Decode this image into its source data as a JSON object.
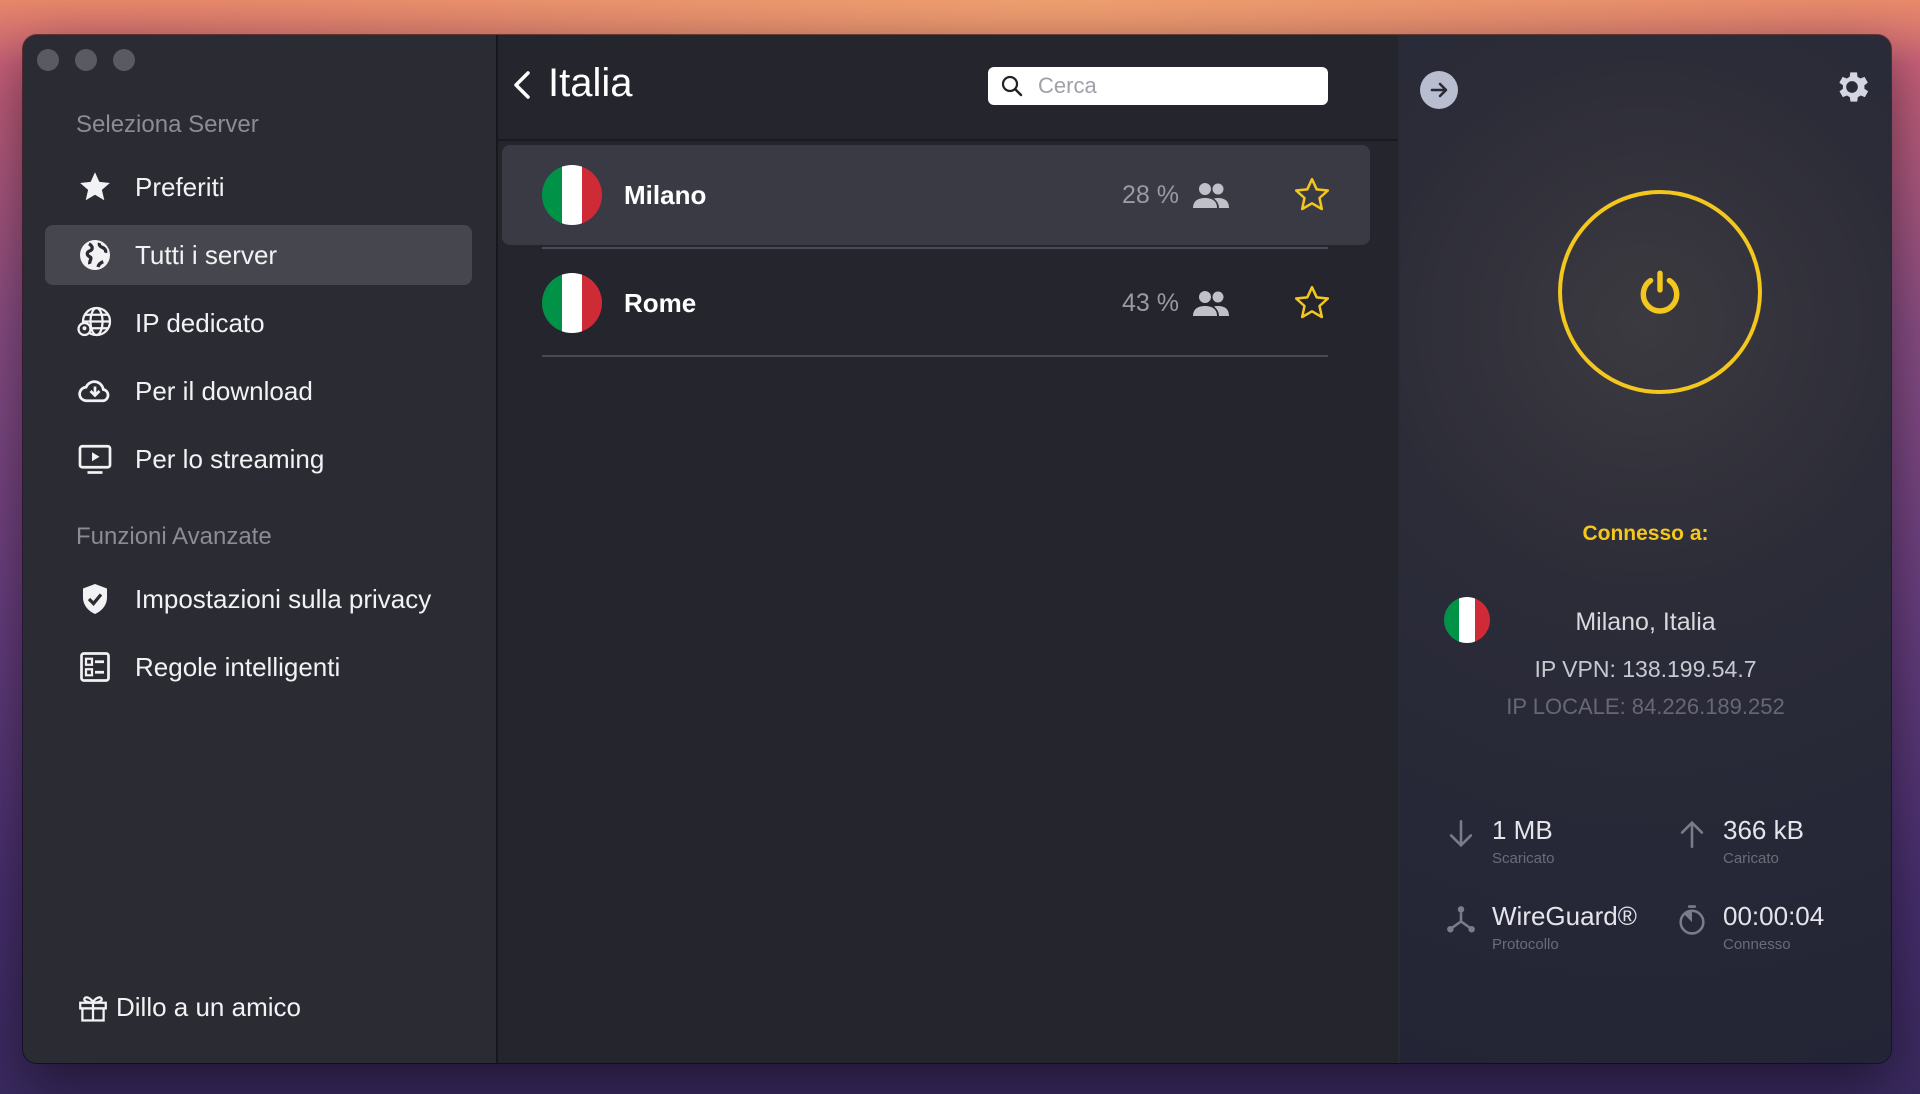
{
  "sidebar": {
    "section_servers": "Seleziona Server",
    "items": [
      {
        "label": "Preferiti",
        "icon": "star-icon"
      },
      {
        "label": "Tutti i server",
        "icon": "globe-icon"
      },
      {
        "label": "IP dedicato",
        "icon": "dedicated-ip-icon"
      },
      {
        "label": "Per il download",
        "icon": "cloud-download-icon"
      },
      {
        "label": "Per lo streaming",
        "icon": "play-screen-icon"
      }
    ],
    "section_advanced": "Funzioni Avanzate",
    "advanced_items": [
      {
        "label": "Impostazioni sulla privacy",
        "icon": "shield-check-icon"
      },
      {
        "label": "Regole intelligenti",
        "icon": "rules-list-icon"
      }
    ],
    "friend_label": "Dillo a un amico"
  },
  "server_list": {
    "title": "Italia",
    "search_placeholder": "Cerca",
    "servers": [
      {
        "name": "Milano",
        "load": "28 %",
        "selected": true
      },
      {
        "name": "Rome",
        "load": "43 %",
        "selected": false
      }
    ]
  },
  "connection": {
    "label": "Connesso a:",
    "location": "Milano, Italia",
    "ip_vpn": "IP VPN: 138.199.54.7",
    "ip_local": "IP LOCALE: 84.226.189.252",
    "downloaded_value": "1 MB",
    "downloaded_label": "Scaricato",
    "uploaded_value": "366 kB",
    "uploaded_label": "Caricato",
    "protocol_value": "WireGuard®",
    "protocol_label": "Protocollo",
    "time_value": "00:00:04",
    "time_label": "Connesso"
  },
  "colors": {
    "accent": "#f3c71d",
    "flag_green": "#009246",
    "flag_white": "#ffffff",
    "flag_red": "#ce2b37"
  }
}
